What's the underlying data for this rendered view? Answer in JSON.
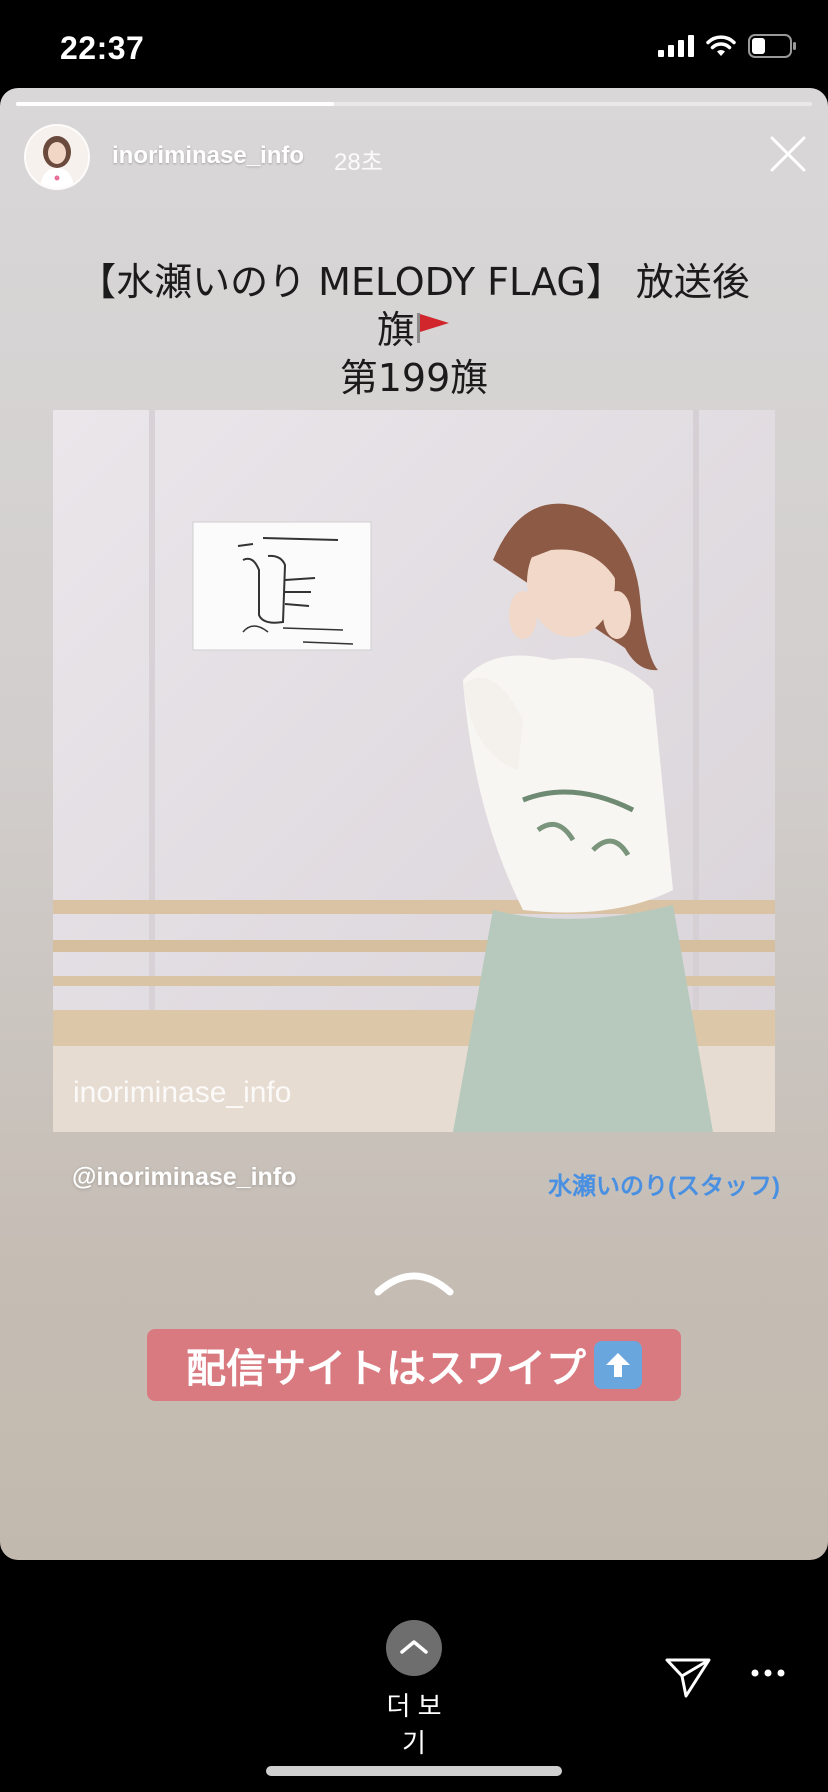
{
  "status_bar": {
    "time": "22:37",
    "battery_level": 0.35
  },
  "story": {
    "progress_fraction": 0.4,
    "username": "inoriminase_info",
    "timestamp": "28초",
    "title_line1": "【水瀬いのり MELODY FLAG】 放送後旗",
    "title_line2": "第199旗",
    "photo_watermark": "inoriminase_info",
    "mention": "@inoriminase_info",
    "staff_link": "水瀬いのり(スタッフ)",
    "swipe_banner": "配信サイトはスワイプ"
  },
  "bottom_bar": {
    "more_label": "더 보기"
  },
  "colors": {
    "link": "#4a90e2",
    "banner": "#d97a80",
    "flag": "#d0262c"
  },
  "icons": [
    "signal-icon",
    "wifi-icon",
    "battery-icon",
    "close-icon",
    "flag-icon",
    "chevron-up-icon",
    "up-arrow-emoji-icon",
    "send-icon",
    "more-options-icon"
  ]
}
